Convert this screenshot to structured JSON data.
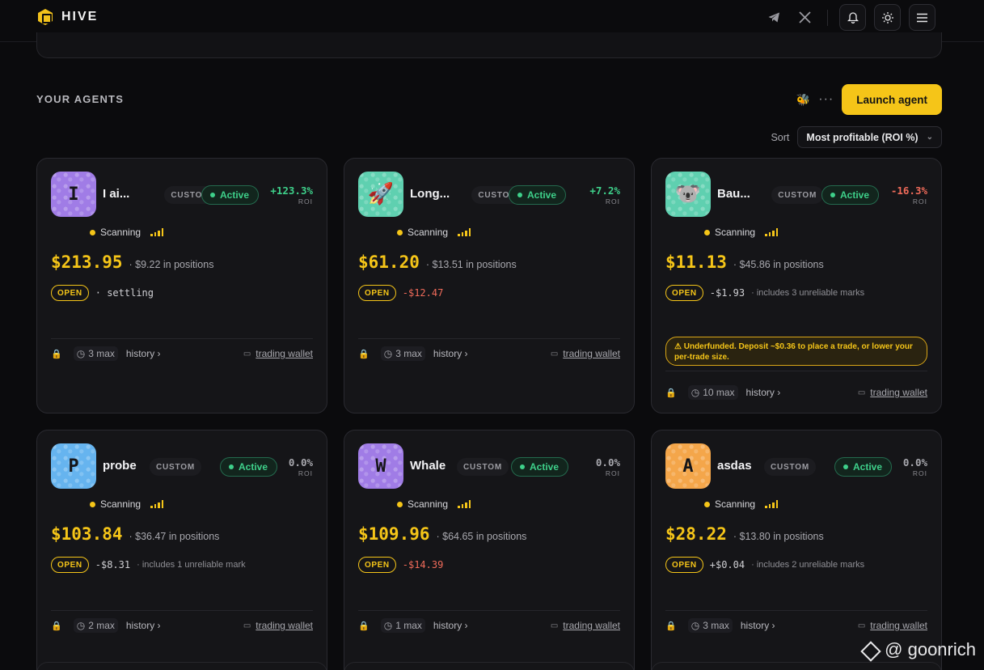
{
  "app": {
    "name": "HIVE"
  },
  "header": {
    "icons": [
      "telegram-icon",
      "x-icon",
      "bell-icon",
      "sun-icon",
      "menu-icon"
    ]
  },
  "section": {
    "title": "YOUR AGENTS",
    "launch_label": "Launch agent",
    "more_label": "···",
    "sort_label": "Sort",
    "sort_value": "Most profitable (ROI %)"
  },
  "labels": {
    "custom": "CUSTOM",
    "active": "Active",
    "roi": "ROI",
    "scanning": "Scanning",
    "in_positions": "in positions",
    "open": "OPEN",
    "history": "history ›",
    "wallet": "trading wallet"
  },
  "agents": [
    {
      "name": "I ai...",
      "avatar": "I",
      "avatar_color": "purple",
      "roi": "+123.3%",
      "roi_sign": "pos",
      "balance": "$213.95",
      "positions": "· $9.22 in positions",
      "pnl": "· settling",
      "pnl_sign": "neutral",
      "note": "",
      "max": "3 max",
      "warning": ""
    },
    {
      "name": "Long...",
      "avatar": "🚀",
      "avatar_color": "teal",
      "roi": "+7.2%",
      "roi_sign": "pos",
      "balance": "$61.20",
      "positions": "· $13.51 in positions",
      "pnl": "-$12.47",
      "pnl_sign": "neg",
      "note": "",
      "max": "3 max",
      "warning": ""
    },
    {
      "name": "Bau...",
      "avatar": "🐨",
      "avatar_color": "teal",
      "roi": "-16.3%",
      "roi_sign": "neg",
      "balance": "$11.13",
      "positions": "· $45.86 in positions",
      "pnl": "-$1.93",
      "pnl_sign": "neutral",
      "note": "· includes 3 unreliable marks",
      "max": "10 max",
      "warning": "⚠ Underfunded. Deposit ~$0.36 to place a trade, or lower your per-trade size."
    },
    {
      "name": "probe",
      "avatar": "P",
      "avatar_color": "blue",
      "roi": "0.0%",
      "roi_sign": "zero",
      "balance": "$103.84",
      "positions": "· $36.47 in positions",
      "pnl": "-$8.31",
      "pnl_sign": "neutral",
      "note": "· includes 1 unreliable mark",
      "max": "2 max",
      "warning": ""
    },
    {
      "name": "Whale",
      "avatar": "W",
      "avatar_color": "purple",
      "roi": "0.0%",
      "roi_sign": "zero",
      "balance": "$109.96",
      "positions": "· $64.65 in positions",
      "pnl": "-$14.39",
      "pnl_sign": "neg",
      "note": "",
      "max": "1 max",
      "warning": ""
    },
    {
      "name": "asdas",
      "avatar": "A",
      "avatar_color": "orange",
      "roi": "0.0%",
      "roi_sign": "zero",
      "balance": "$28.22",
      "positions": "· $13.80 in positions",
      "pnl": "+$0.04",
      "pnl_sign": "neutral",
      "note": "· includes 2 unreliable marks",
      "max": "3 max",
      "warning": ""
    }
  ],
  "watermark": "@ goonrich"
}
